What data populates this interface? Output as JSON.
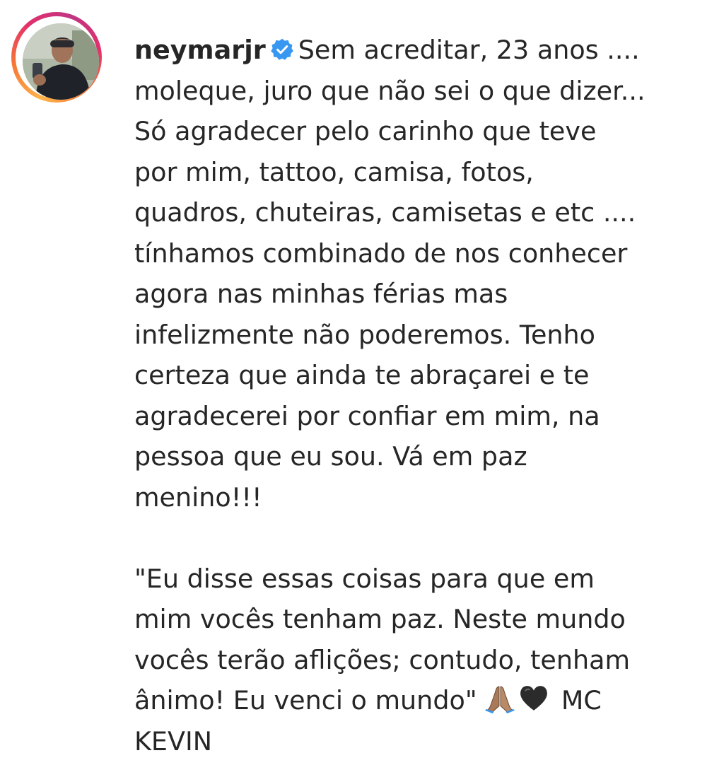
{
  "post": {
    "author": {
      "username": "neymarjr",
      "verified_icon": "verified-badge-icon",
      "avatar": "profile-photo"
    },
    "caption": {
      "lines": [
        "Sem acreditar, 23 anos ....",
        "moleque, juro que não sei o que dizer...",
        "Só agradecer pelo carinho que teve",
        "por mim, tattoo, camisa, fotos,",
        "quadros, chuteiras, camisetas e etc ....",
        "tínhamos combinado de nos conhecer",
        "agora nas minhas férias mas",
        "infelizmente não poderemos. Tenho",
        "certeza que ainda te abraçarei e te",
        "agradecerei por confiar em mim, na",
        "pessoa que eu sou. Vá em paz",
        "menino!!!",
        "",
        "\"Eu disse essas coisas para que em",
        "mim vocês tenham paz. Neste mundo",
        "vocês terão aflições; contudo, tenham",
        "ânimo! Eu venci o mundo\"",
        "MC",
        "KEVIN"
      ],
      "emojis": [
        "praying-hands-icon",
        "black-heart-icon"
      ]
    },
    "colors": {
      "text": "#262626",
      "verified": "#3897f0"
    }
  }
}
